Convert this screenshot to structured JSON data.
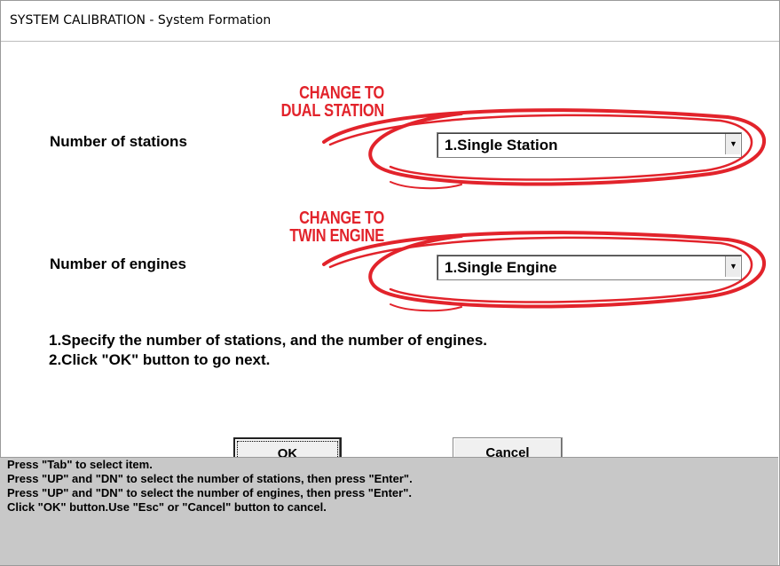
{
  "window": {
    "title": "SYSTEM CALIBRATION - System Formation"
  },
  "stations": {
    "label": "Number of stations",
    "selected": "1.Single Station",
    "annotation": [
      "CHANGE TO",
      "DUAL STATION"
    ]
  },
  "engines": {
    "label": "Number of engines",
    "selected": "1.Single Engine",
    "annotation": [
      "CHANGE TO",
      "TWIN ENGINE"
    ]
  },
  "instructions": [
    "1.Specify the number of stations, and the number of engines.",
    "2.Click \"OK\" button to go next."
  ],
  "buttons": {
    "ok": "OK",
    "cancel": "Cancel"
  },
  "status": [
    "Press \"Tab\" to select item.",
    "Press \"UP\" and \"DN\" to select the number of stations, then press \"Enter\".",
    "Press \"UP\" and \"DN\" to select the number of engines, then press \"Enter\".",
    "Click \"OK\" button.Use \"Esc\" or \"Cancel\" button to cancel."
  ],
  "colors": {
    "annotation": "#e2232b",
    "status_bg": "#c8c8c8"
  },
  "icons": {
    "dropdown": "chevron-down-icon"
  }
}
